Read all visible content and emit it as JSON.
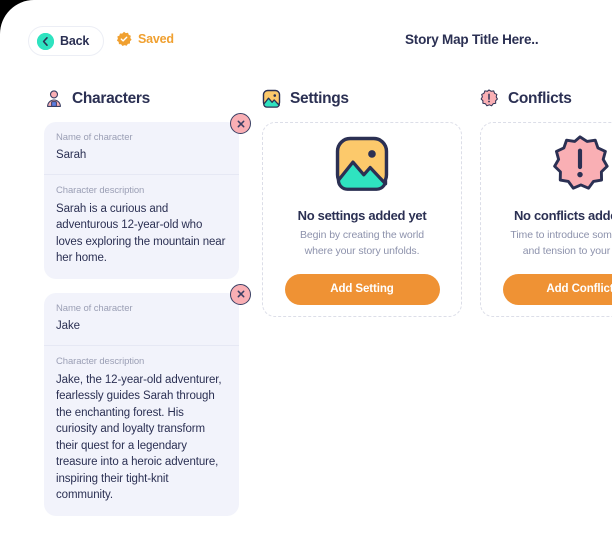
{
  "topbar": {
    "back_label": "Back",
    "back_icon": "chevron-left-circle-icon",
    "saved_label": "Saved",
    "saved_icon": "saved-badge-check-icon",
    "title": "Story Map Title Here.."
  },
  "colors": {
    "accent_orange": "#ef9234",
    "saved_orange": "#f0a030",
    "navy_text": "#2b3053",
    "muted_text": "#8d92ac",
    "label_text": "#9b9fb5",
    "card_bg": "#f2f3fb",
    "dashed_border": "#dcdee8",
    "close_pink": "#f9afb4",
    "teal": "#2fe3c0"
  },
  "columns": [
    {
      "key": "characters",
      "title": "Characters",
      "icon": "person-icon",
      "state": "filled",
      "cards": [
        {
          "name_label": "Name of character",
          "name_value": "Sarah",
          "desc_label": "Character description",
          "desc_value": "Sarah is a curious and adventurous 12-year-old who loves exploring the mountain near her home.",
          "close_icon": "close-icon"
        },
        {
          "name_label": "Name of character",
          "name_value": "Jake",
          "desc_label": "Character description",
          "desc_value": "Jake, the 12-year-old adventurer, fearlessly guides Sarah through the enchanting forest. His curiosity and loyalty transform their quest for a legendary treasure into a heroic adventure, inspiring their tight-knit community.",
          "close_icon": "close-icon"
        }
      ]
    },
    {
      "key": "settings",
      "title": "Settings",
      "icon": "image-landscape-icon",
      "state": "empty",
      "empty": {
        "icon": "image-landscape-icon",
        "title": "No settings added yet",
        "sub_line1": "Begin by creating the world",
        "sub_line2": "where your story unfolds.",
        "button_label": "Add Setting"
      }
    },
    {
      "key": "conflicts",
      "title": "Conflicts",
      "icon": "exclamation-burst-icon",
      "state": "empty",
      "empty": {
        "icon": "exclamation-burst-icon",
        "title": "No conflicts added yet",
        "sub_line1": "Time to introduce some drama",
        "sub_line2": "and tension to your story.",
        "button_label": "Add Conflict"
      }
    }
  ]
}
